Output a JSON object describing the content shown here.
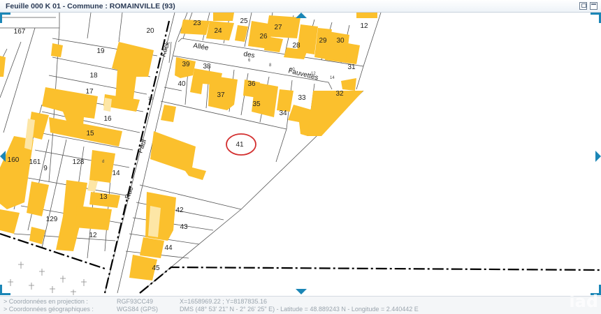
{
  "window": {
    "title": "Feuille 000 K 01 - Commune : ROMAINVILLE (93)",
    "restore_icon": "restore-icon",
    "maximize_icon": "maximize-icon"
  },
  "map": {
    "parcels": [
      "167",
      "20",
      "23",
      "24",
      "25",
      "26",
      "27",
      "12",
      "19",
      "28",
      "29",
      "30",
      "31",
      "39",
      "38",
      "18",
      "40",
      "37",
      "36",
      "33",
      "32",
      "17",
      "35",
      "34",
      "16",
      "15",
      "41",
      "160",
      "161",
      "9",
      "128",
      "14",
      "13",
      "42",
      "129",
      "43",
      "12",
      "44",
      "45"
    ],
    "street_labels": [
      "Rue",
      "Paul",
      "Kock",
      "Allée",
      "des",
      "Fauvettes"
    ],
    "small_labels": [
      "d",
      "18",
      "6",
      "8",
      "10",
      "12",
      "14"
    ],
    "colors": {
      "building": "#fbc02d",
      "building_light": "#fde6a6",
      "annotation": "#d32f2f",
      "nav": "#1b86b6"
    }
  },
  "footer": {
    "projection": {
      "label": "> Coordonnées en projection :",
      "system": "RGF93CC49",
      "value": "X=1658969.22 ; Y=8187835.16"
    },
    "geographic": {
      "label": "> Coordonnées géographiques :",
      "system": "WGS84 (GPS)",
      "value": "DMS (48° 53' 21\" N - 2° 26' 25\" E) - Latitude = 48.889243 N - Longitude = 2.440442 E"
    }
  },
  "watermark": "iad"
}
